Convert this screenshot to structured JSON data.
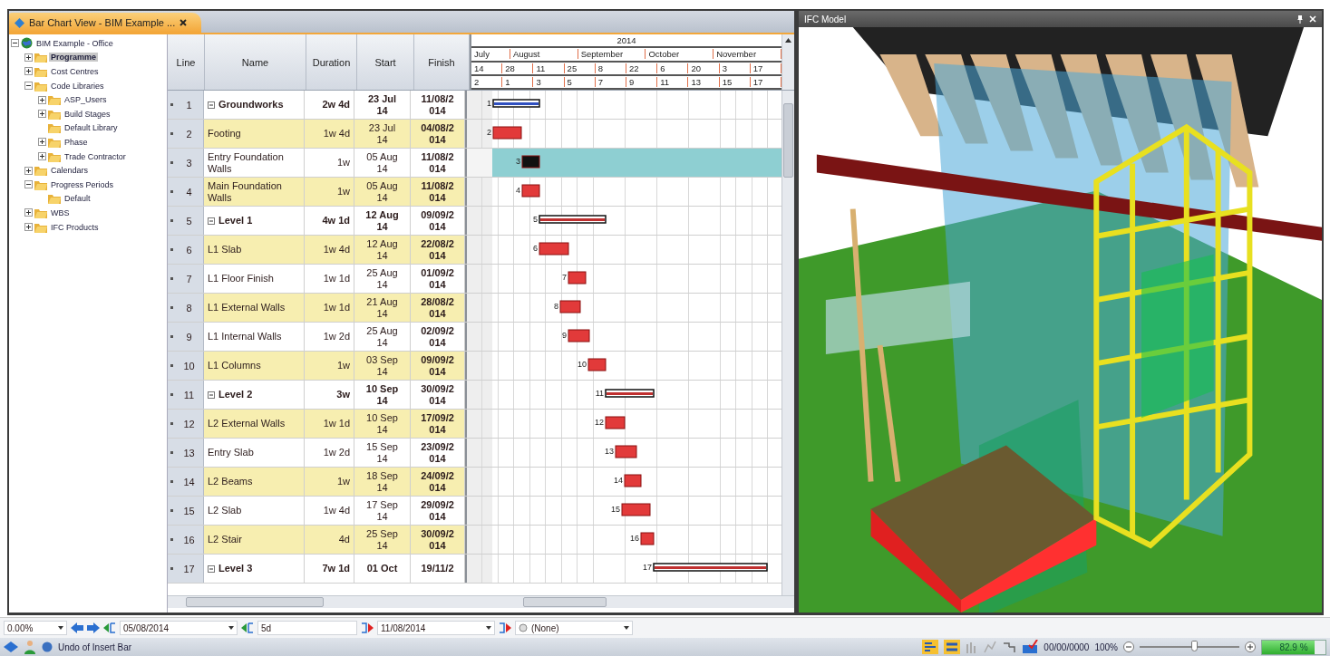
{
  "tab": {
    "title": "Bar Chart View - BIM Example ..."
  },
  "tree": [
    {
      "label": "BIM Example - Office",
      "expanded": true,
      "selected": false,
      "children": [
        {
          "label": "Programme",
          "expanded": false,
          "selected": true
        },
        {
          "label": "Cost Centres",
          "expanded": false,
          "selected": false
        },
        {
          "label": "Code Libraries",
          "expanded": true,
          "selected": false,
          "children": [
            {
              "label": "ASP_Users",
              "expanded": false,
              "selected": false
            },
            {
              "label": "Build Stages",
              "expanded": false,
              "selected": false
            },
            {
              "label": "Default Library",
              "selected": false
            },
            {
              "label": "Phase",
              "expanded": false,
              "selected": false
            },
            {
              "label": "Trade Contractor",
              "expanded": false,
              "selected": false
            }
          ]
        },
        {
          "label": "Calendars",
          "expanded": false,
          "selected": false
        },
        {
          "label": "Progress Periods",
          "expanded": true,
          "selected": false,
          "children": [
            {
              "label": "Default",
              "selected": false
            }
          ]
        },
        {
          "label": "WBS",
          "expanded": false,
          "selected": false
        },
        {
          "label": "IFC Products",
          "expanded": false,
          "selected": false
        }
      ]
    }
  ],
  "grid": {
    "columns": [
      "Line",
      "Name",
      "Duration",
      "Start",
      "Finish"
    ],
    "timeline": {
      "year": "2014",
      "months": [
        "July",
        "August",
        "September",
        "October",
        "November"
      ],
      "weeks": [
        "14",
        "28",
        "11",
        "25",
        "8",
        "22",
        "6",
        "20",
        "3",
        "17"
      ],
      "days": [
        "2",
        "1",
        "3",
        "5",
        "7",
        "9",
        "11",
        "13",
        "15",
        "17"
      ]
    },
    "rows": [
      {
        "line": "1",
        "kind": "summary",
        "name": "Groundworks",
        "duration": "2w 4d",
        "start": "23 Jul 14",
        "finish": "11/08/2014",
        "bar_label": "1",
        "selected": false
      },
      {
        "line": "2",
        "kind": "task",
        "name": "Footing",
        "duration": "1w 4d",
        "start": "23 Jul 14",
        "finish": "04/08/2014",
        "bar_label": "2",
        "selected": false
      },
      {
        "line": "3",
        "kind": "task",
        "name": "Entry Foundation Walls",
        "duration": "1w",
        "start": "05 Aug 14",
        "finish": "11/08/2014",
        "bar_label": "3",
        "selected": true
      },
      {
        "line": "4",
        "kind": "task",
        "name": "Main Foundation Walls",
        "duration": "1w",
        "start": "05 Aug 14",
        "finish": "11/08/2014",
        "bar_label": "4",
        "selected": false
      },
      {
        "line": "5",
        "kind": "summary",
        "name": "Level 1",
        "duration": "4w 1d",
        "start": "12 Aug 14",
        "finish": "09/09/2014",
        "bar_label": "5",
        "selected": false
      },
      {
        "line": "6",
        "kind": "task",
        "name": "L1 Slab",
        "duration": "1w 4d",
        "start": "12 Aug 14",
        "finish": "22/08/2014",
        "bar_label": "6",
        "selected": false
      },
      {
        "line": "7",
        "kind": "task",
        "name": "L1 Floor Finish",
        "duration": "1w 1d",
        "start": "25 Aug 14",
        "finish": "01/09/2014",
        "bar_label": "7",
        "selected": false
      },
      {
        "line": "8",
        "kind": "task",
        "name": "L1 External Walls",
        "duration": "1w 1d",
        "start": "21 Aug 14",
        "finish": "28/08/2014",
        "bar_label": "8",
        "selected": false
      },
      {
        "line": "9",
        "kind": "task",
        "name": "L1 Internal Walls",
        "duration": "1w 2d",
        "start": "25 Aug 14",
        "finish": "02/09/2014",
        "bar_label": "9",
        "selected": false
      },
      {
        "line": "10",
        "kind": "task",
        "name": "L1 Columns",
        "duration": "1w",
        "start": "03 Sep 14",
        "finish": "09/09/2014",
        "bar_label": "10",
        "selected": false
      },
      {
        "line": "11",
        "kind": "summary",
        "name": "Level 2",
        "duration": "3w",
        "start": "10 Sep 14",
        "finish": "30/09/2014",
        "bar_label": "11",
        "selected": false
      },
      {
        "line": "12",
        "kind": "task",
        "name": "L2 External Walls",
        "duration": "1w 1d",
        "start": "10 Sep 14",
        "finish": "17/09/2014",
        "bar_label": "12",
        "selected": false
      },
      {
        "line": "13",
        "kind": "task",
        "name": "Entry Slab",
        "duration": "1w 2d",
        "start": "15 Sep 14",
        "finish": "23/09/2014",
        "bar_label": "13",
        "selected": false
      },
      {
        "line": "14",
        "kind": "task",
        "name": "L2 Beams",
        "duration": "1w",
        "start": "18 Sep 14",
        "finish": "24/09/2014",
        "bar_label": "14",
        "selected": false
      },
      {
        "line": "15",
        "kind": "task",
        "name": "L2 Slab",
        "duration": "1w 4d",
        "start": "17 Sep 14",
        "finish": "29/09/2014",
        "bar_label": "15",
        "selected": false
      },
      {
        "line": "16",
        "kind": "task",
        "name": "L2 Stair",
        "duration": "4d",
        "start": "25 Sep 14",
        "finish": "30/09/2014",
        "bar_label": "16",
        "selected": false
      },
      {
        "line": "17",
        "kind": "summary",
        "name": "Level 3",
        "duration": "7w 1d",
        "start": "01 Oct",
        "finish": "19/11/2",
        "bar_label": "17",
        "selected": false
      }
    ]
  },
  "model_panel": {
    "title": "IFC Model"
  },
  "toolbar": {
    "progress": "0.00%",
    "start_date": "05/08/2014",
    "duration": "5d",
    "finish_date": "11/08/2014",
    "calendar": "(None)"
  },
  "status_bar": {
    "action": "Undo of Insert Bar",
    "date": "00/00/0000",
    "zoom": "100%",
    "zoom_slider": {
      "level": 0.55
    },
    "progress": {
      "label": "82.9 %",
      "level": 0.83
    }
  }
}
